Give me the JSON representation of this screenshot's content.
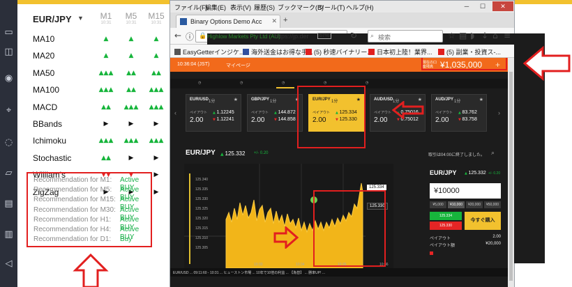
{
  "panel": {
    "pair": "EUR/JPY",
    "timeframes": [
      {
        "label": "M1",
        "sub": "10:31"
      },
      {
        "label": "M5",
        "sub": "10:31"
      },
      {
        "label": "M15",
        "sub": "10:31"
      }
    ],
    "indicators": [
      {
        "name": "MA10",
        "m1": "▲",
        "m5": "▲",
        "m15": "▲",
        "m1c": "up",
        "m5c": "up",
        "m15c": "up"
      },
      {
        "name": "MA20",
        "m1": "▲",
        "m5": "▲",
        "m15": "▲",
        "m1c": "up",
        "m5c": "up",
        "m15c": "up"
      },
      {
        "name": "MA50",
        "m1": "▲▲▲",
        "m5": "▲▲",
        "m15": "▲▲",
        "m1c": "up",
        "m5c": "up",
        "m15c": "up"
      },
      {
        "name": "MA100",
        "m1": "▲▲▲",
        "m5": "▲▲",
        "m15": "▲▲▲",
        "m1c": "up",
        "m5c": "up",
        "m15c": "up"
      },
      {
        "name": "MACD",
        "m1": "▲▲",
        "m5": "▲▲▲",
        "m15": "▲▲▲",
        "m1c": "up",
        "m5c": "up",
        "m15c": "up"
      },
      {
        "name": "BBands",
        "m1": "▶",
        "m5": "▶",
        "m15": "▶",
        "m1c": "side",
        "m5c": "side",
        "m15c": "side"
      },
      {
        "name": "Ichimoku",
        "m1": "▲▲▲",
        "m5": "▲▲▲",
        "m15": "▲▲▲",
        "m1c": "up",
        "m5c": "up",
        "m15c": "up"
      },
      {
        "name": "Stochastic",
        "m1": "▲▲",
        "m5": "▶",
        "m15": "▶",
        "m1c": "up",
        "m5c": "side",
        "m15c": "side"
      },
      {
        "name": "William's",
        "m1": "▼▼",
        "m5": "▼",
        "m15": "▶",
        "m1c": "down",
        "m5c": "down",
        "m15c": "side"
      },
      {
        "name": "ZigZag",
        "m1": "▶",
        "m5": "▶",
        "m15": "▶",
        "m1c": "side",
        "m5c": "side",
        "m15c": "side"
      }
    ],
    "recommendations": [
      {
        "label": "Recommendation for M1:",
        "value": "Active BUY"
      },
      {
        "label": "Recommendation for M5:",
        "value": "Active BUY"
      },
      {
        "label": "Recommendation for M15:",
        "value": "Active BUY"
      },
      {
        "label": "Recommendation for M30:",
        "value": "Active BUY"
      },
      {
        "label": "Recommendation for H1:",
        "value": "Active BUY"
      },
      {
        "label": "Recommendation for H4:",
        "value": "Active BUY"
      },
      {
        "label": "Recommendation for D1:",
        "value": "Buy"
      }
    ]
  },
  "browser": {
    "menu": [
      "ファイル(F)",
      "編集(E)",
      "表示(V)",
      "履歴(S)",
      "ブックマーク(B)",
      "ツール(T)",
      "ヘルプ(H)"
    ],
    "tab_title": "Binary Options Demo Acc",
    "site_label": "Highlow Markets Pty Ltd (AU)",
    "url": "https://jp.der",
    "zoom": "67%",
    "search_placeholder": "検索",
    "bookmarks": [
      "EasyGetterインジケ...",
      "海外送金はお得な手...",
      "(5) 秒速バイナリー...",
      "日本初上陸！業界...",
      "(5) 副業・投資ス-..."
    ]
  },
  "site": {
    "clock": "10:36:04 (JST)",
    "mypage": "マイページ",
    "balance_label": "現在の口座残高",
    "balance": "¥1,035,000",
    "cards": [
      {
        "pair": "EUR/USD",
        "time": "1分",
        "payout": "2.00",
        "ask": "1.12245",
        "bid": "1.12241"
      },
      {
        "pair": "GBP/JPY",
        "time": "1分",
        "payout": "2.00",
        "ask": "144.872",
        "bid": "144.858"
      },
      {
        "pair": "EUR/JPY",
        "time": "1分",
        "payout": "2.00",
        "ask": "125.334",
        "bid": "125.330"
      },
      {
        "pair": "AUD/USD",
        "time": "1分",
        "payout": "2.00",
        "ask": "0.75016",
        "bid": "0.75012"
      },
      {
        "pair": "AUD/JPY",
        "time": "1分",
        "payout": "2.00",
        "ask": "83.762",
        "bid": "83.758"
      }
    ],
    "payout_label": "ペイアウト",
    "chart_pair": "EUR/JPY",
    "chart_rate": "125.332",
    "chart_change": "+/- 0.20",
    "chart_note": "取引は04:00に終了しました。",
    "price_tags": [
      "125.334",
      "125.330"
    ],
    "yaxis": [
      "125.340",
      "125.335",
      "125.330",
      "125.325",
      "125.320",
      "125.315",
      "125.310",
      "125.305"
    ],
    "xaxis": [
      "10:33",
      "10:34",
      "10:35",
      "10:36"
    ],
    "order": {
      "pair": "EUR/JPY",
      "rate": "125.332",
      "change": "+/- 0.20",
      "amount": "¥10000",
      "chips": [
        "¥5,000",
        "¥10,000",
        "¥20,000",
        "¥50,000"
      ],
      "high_rate": "125.334",
      "low_rate": "125.330",
      "buy_now": "今すぐ購入",
      "payout_rate_label": "ペイアウト",
      "payout_rate": "2.00",
      "payout_amt_label": "ペイアウト額",
      "payout_amt": "¥20,000"
    },
    "ticker": "EUR/USD ... 09:11:60 - 10:31  ... ヒューストン市場 ...  10年で10倍の利益 ...  【為替】 ... 勝率UP! ..."
  }
}
